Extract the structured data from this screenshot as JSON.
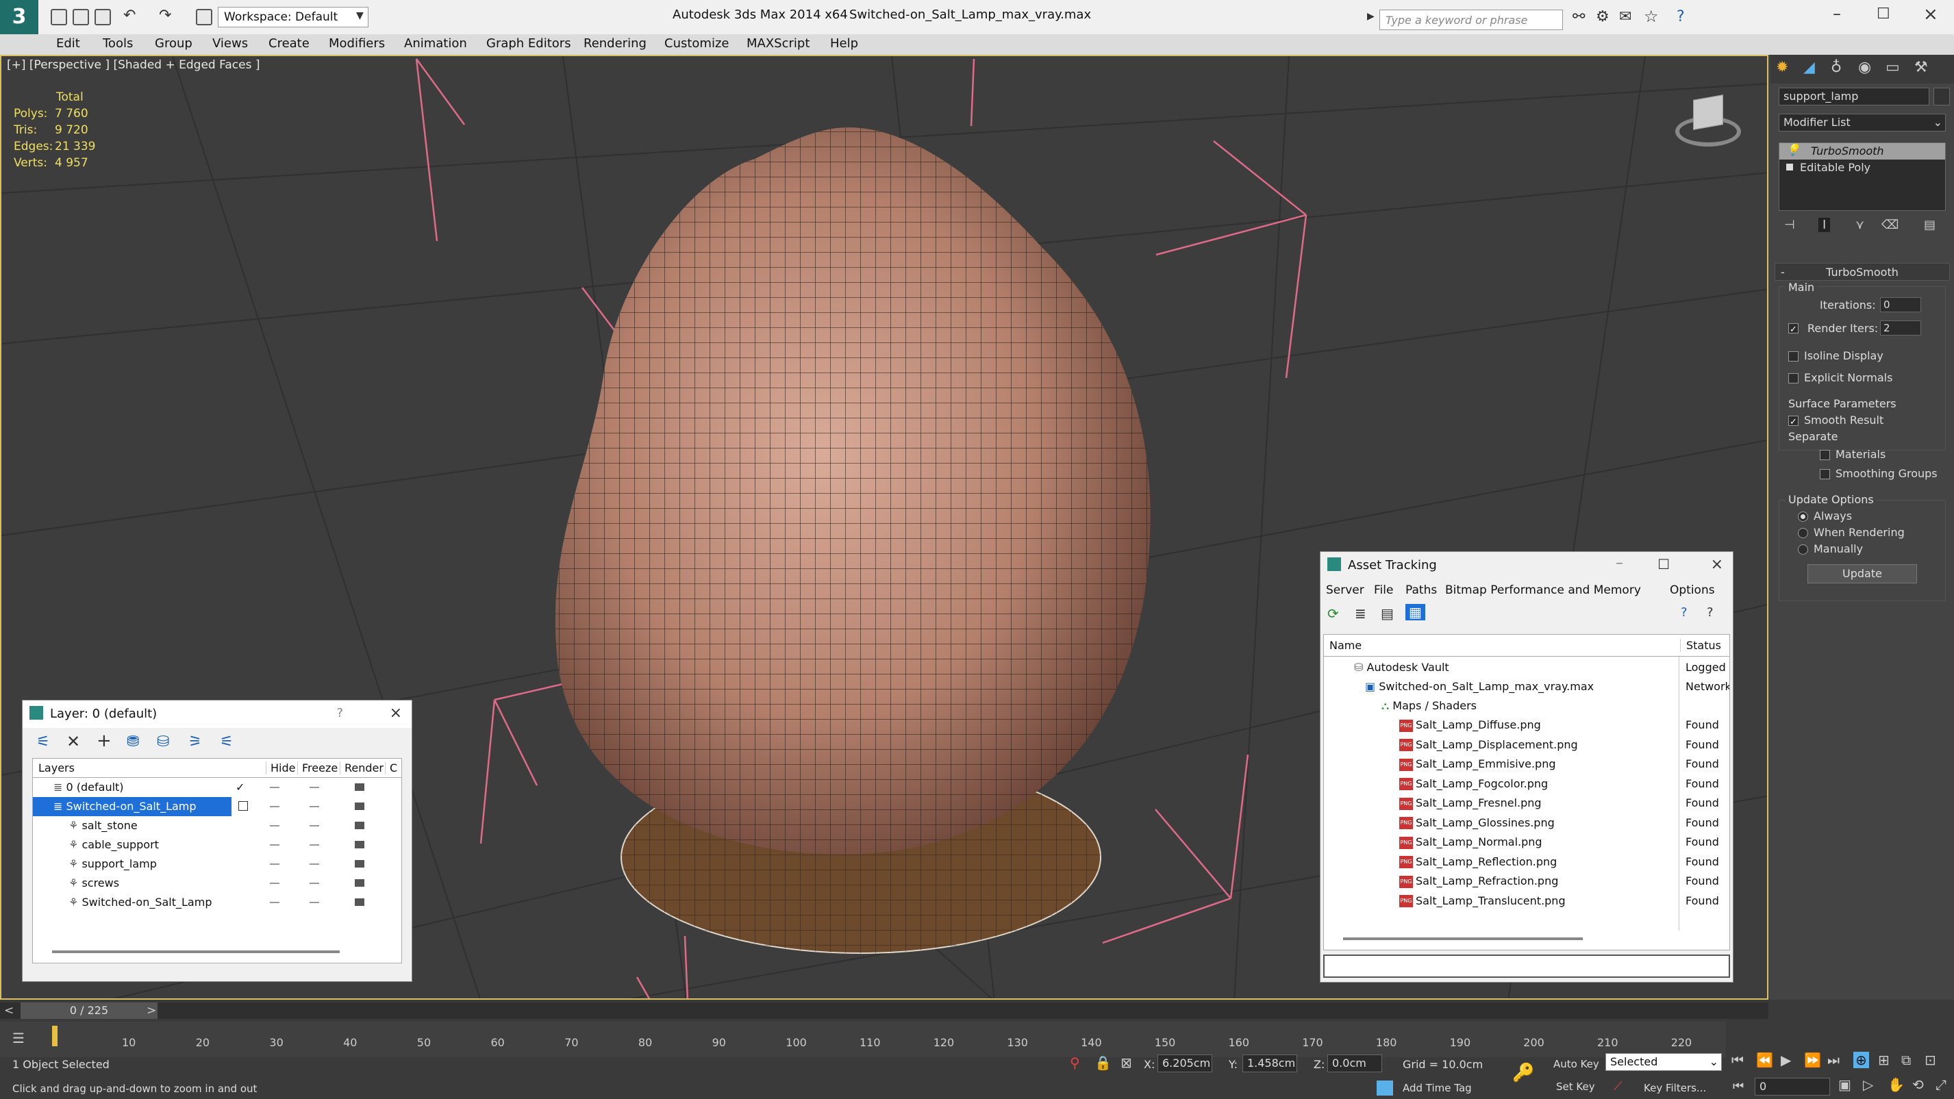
{
  "title": {
    "app": "Autodesk 3ds Max  2014 x64",
    "file": "Switched-on_Salt_Lamp_max_vray.max"
  },
  "workspace": "Workspace: Default",
  "search_placeholder": "Type a keyword or phrase",
  "menu": [
    "Edit",
    "Tools",
    "Group",
    "Views",
    "Create",
    "Modifiers",
    "Animation",
    "Graph Editors",
    "Rendering",
    "Customize",
    "MAXScript",
    "Help"
  ],
  "viewport": {
    "label": "[+] [Perspective ] [Shaded + Edged Faces ]",
    "stats": {
      "total": "Total",
      "polys_l": "Polys:",
      "polys": "7 760",
      "tris_l": "Tris:",
      "tris": "9 720",
      "edges_l": "Edges:",
      "edges": "21 339",
      "verts_l": "Verts:",
      "verts": "4 957"
    }
  },
  "command_panel": {
    "object_name": "support_lamp",
    "modifier_list": "Modifier List",
    "stack": [
      "TurboSmooth",
      "Editable Poly"
    ],
    "rollout": "TurboSmooth",
    "main": "Main",
    "iterations_l": "Iterations:",
    "iterations": "0",
    "render_iters_l": "Render Iters:",
    "render_iters": "2",
    "isoline": "Isoline Display",
    "explicit": "Explicit Normals",
    "surface": "Surface Parameters",
    "smooth": "Smooth Result",
    "separate": "Separate",
    "materials": "Materials",
    "smoothing": "Smoothing Groups",
    "update_opts": "Update Options",
    "always": "Always",
    "when_rendering": "When Rendering",
    "manually": "Manually",
    "update_btn": "Update"
  },
  "layer_window": {
    "title": "Layer: 0 (default)",
    "help": "?",
    "cols": {
      "layers": "Layers",
      "hide": "Hide",
      "freeze": "Freeze",
      "render": "Render",
      "c": "C"
    },
    "rows": [
      {
        "name": "0 (default)",
        "indent": 0
      },
      {
        "name": "Switched-on_Salt_Lamp",
        "indent": 0
      },
      {
        "name": "salt_stone",
        "indent": 1
      },
      {
        "name": "cable_support",
        "indent": 1
      },
      {
        "name": "support_lamp",
        "indent": 1
      },
      {
        "name": "screws",
        "indent": 1
      },
      {
        "name": "Switched-on_Salt_Lamp",
        "indent": 1
      }
    ]
  },
  "asset_window": {
    "title": "Asset Tracking",
    "menu": [
      "Server",
      "File",
      "Paths",
      "Bitmap Performance and Memory",
      "Options"
    ],
    "col_name": "Name",
    "col_status": "Status",
    "vault": "Autodesk Vault",
    "vault_status": "Logged",
    "file": "Switched-on_Salt_Lamp_max_vray.max",
    "file_status": "Network",
    "maps": "Maps / Shaders",
    "png_tag": "PNG",
    "items": [
      "Salt_Lamp_Diffuse.png",
      "Salt_Lamp_Displacement.png",
      "Salt_Lamp_Emmisive.png",
      "Salt_Lamp_Fogcolor.png",
      "Salt_Lamp_Fresnel.png",
      "Salt_Lamp_Glossines.png",
      "Salt_Lamp_Normal.png",
      "Salt_Lamp_Reflection.png",
      "Salt_Lamp_Refraction.png",
      "Salt_Lamp_Translucent.png"
    ],
    "item_status": "Found"
  },
  "timeline": {
    "frame": "0 / 225",
    "ticks": [
      "10",
      "20",
      "30",
      "40",
      "50",
      "60",
      "70",
      "80",
      "90",
      "100",
      "110",
      "120",
      "130",
      "140",
      "150",
      "160",
      "170",
      "180",
      "190",
      "200",
      "210",
      "220"
    ]
  },
  "status": {
    "selected": "1 Object Selected",
    "hint": "Click and drag up-and-down to zoom in and out",
    "x_l": "X:",
    "x": "6.205cm",
    "y_l": "Y:",
    "y": "1.458cm",
    "z_l": "Z:",
    "z": "0.0cm",
    "grid": "Grid = 10.0cm",
    "add_time_tag": "Add Time Tag",
    "auto_key": "Auto Key",
    "set_key": "Set Key",
    "selected_dd": "Selected",
    "key_filters": "Key Filters...",
    "frame_field": "0"
  }
}
